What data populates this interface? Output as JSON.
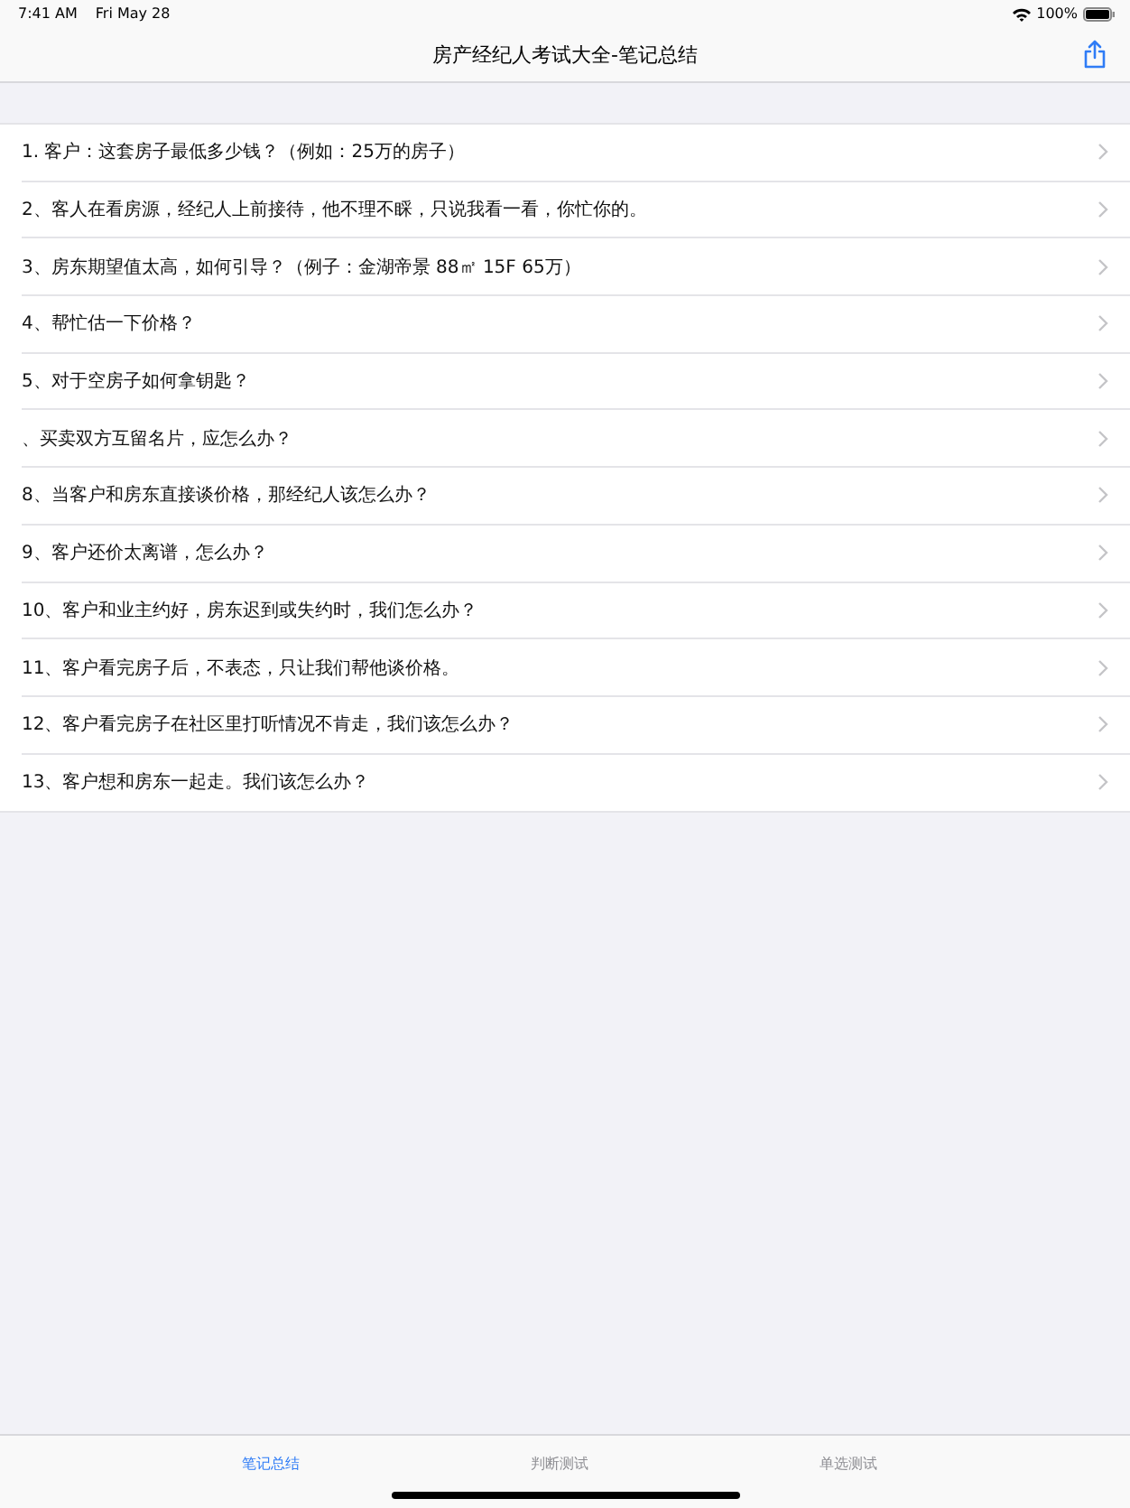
{
  "status_bar": {
    "time": "7:41 AM",
    "date": "Fri May 28",
    "battery": "100%"
  },
  "nav_bar": {
    "title": "房产经纪人考试大全-笔记总结"
  },
  "list": [
    {
      "text": "1.  客户：这套房子最低多少钱？（例如：25万的房子）"
    },
    {
      "text": "2、客人在看房源，经纪人上前接待，他不理不睬，只说我看一看，你忙你的。"
    },
    {
      "text": "3、房东期望值太高，如何引导？（例子：金湖帝景 88㎡ 15F 65万）"
    },
    {
      "text": "4、帮忙估一下价格？"
    },
    {
      "text": "5、对于空房子如何拿钥匙？"
    },
    {
      "text": "、买卖双方互留名片，应怎么办？"
    },
    {
      "text": "8、当客户和房东直接谈价格，那经纪人该怎么办？"
    },
    {
      "text": "9、客户还价太离谱，怎么办？"
    },
    {
      "text": "10、客户和业主约好，房东迟到或失约时，我们怎么办？"
    },
    {
      "text": "11、客户看完房子后，不表态，只让我们帮他谈价格。"
    },
    {
      "text": "12、客户看完房子在社区里打听情况不肯走，我们该怎么办？"
    },
    {
      "text": "13、客户想和房东一起走。我们该怎么办？"
    }
  ],
  "tab_bar": [
    {
      "label": "笔记总结",
      "selected": true
    },
    {
      "label": "判断测试",
      "selected": false
    },
    {
      "label": "单选测试",
      "selected": false
    }
  ]
}
